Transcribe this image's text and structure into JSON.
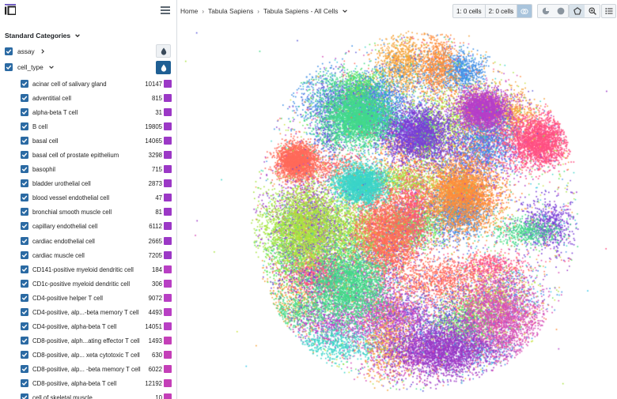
{
  "header": {
    "breadcrumb": [
      "Home",
      "Tabula Sapiens",
      "Tabula Sapiens - All Cells"
    ],
    "selection_1": "1: 0 cells",
    "selection_2": "2: 0 cells",
    "selection_icon": "venn-icon"
  },
  "sidebar": {
    "section_title": "Standard Categories",
    "categories": [
      {
        "label": "assay",
        "checked": true,
        "expanded": false
      },
      {
        "label": "cell_type",
        "checked": true,
        "expanded": true
      }
    ],
    "cell_types": [
      {
        "label": "acinar cell of salivary gland",
        "count": "10147",
        "color": "#9b38c6"
      },
      {
        "label": "adventitial cell",
        "count": "815",
        "color": "#9b38c6"
      },
      {
        "label": "alpha-beta T cell",
        "count": "31",
        "color": "#9b38c6"
      },
      {
        "label": "B cell",
        "count": "19805",
        "color": "#9b38c6"
      },
      {
        "label": "basal cell",
        "count": "14065",
        "color": "#9b38c6"
      },
      {
        "label": "basal cell of prostate epithelium",
        "count": "3298",
        "color": "#9b38c6"
      },
      {
        "label": "basophil",
        "count": "715",
        "color": "#9b38c6"
      },
      {
        "label": "bladder urothelial cell",
        "count": "2873",
        "color": "#9b38c6"
      },
      {
        "label": "blood vessel endothelial cell",
        "count": "47",
        "color": "#9b38c6"
      },
      {
        "label": "bronchial smooth muscle cell",
        "count": "81",
        "color": "#9b38c6"
      },
      {
        "label": "capillary endothelial cell",
        "count": "6112",
        "color": "#9b38c6"
      },
      {
        "label": "cardiac endothelial cell",
        "count": "2665",
        "color": "#9b38c6"
      },
      {
        "label": "cardiac muscle cell",
        "count": "7205",
        "color": "#9b38c6"
      },
      {
        "label": "CD141-positive myeloid dendritic cell",
        "count": "184",
        "color": "#b83fc4"
      },
      {
        "label": "CD1c-positive myeloid dendritic cell",
        "count": "306",
        "color": "#b83fc4"
      },
      {
        "label": "CD4-positive helper T cell",
        "count": "9072",
        "color": "#b83fc4"
      },
      {
        "label": "CD4-positive, alp...-beta memory T cell",
        "count": "4493",
        "color": "#b83fc4"
      },
      {
        "label": "CD4-positive, alpha-beta T cell",
        "count": "14051",
        "color": "#b83fc4"
      },
      {
        "label": "CD8-positive, alph...ating effector T cell",
        "count": "1493",
        "color": "#c43fb8"
      },
      {
        "label": "CD8-positive, alp... xeta cytotoxic T cell",
        "count": "630",
        "color": "#c43fb8"
      },
      {
        "label": "CD8-positive, alp... -beta memory T cell",
        "count": "6022",
        "color": "#c43fb8"
      },
      {
        "label": "CD8-positive, alpha-beta T cell",
        "count": "12192",
        "color": "#c43fb8"
      },
      {
        "label": "cell of skeletal muscle",
        "count": "10",
        "color": "#c43fb8"
      }
    ]
  },
  "embedding_palette": [
    "#9b38c6",
    "#b63fc9",
    "#d64fb7",
    "#ff4f82",
    "#ff6a5a",
    "#ff8c3a",
    "#f5a33b",
    "#c9e23f",
    "#a7e33f",
    "#5fe55a",
    "#43d98a",
    "#3bd4c8",
    "#35c7e8",
    "#3f8fe6",
    "#5a58d8",
    "#7a3fd6"
  ]
}
